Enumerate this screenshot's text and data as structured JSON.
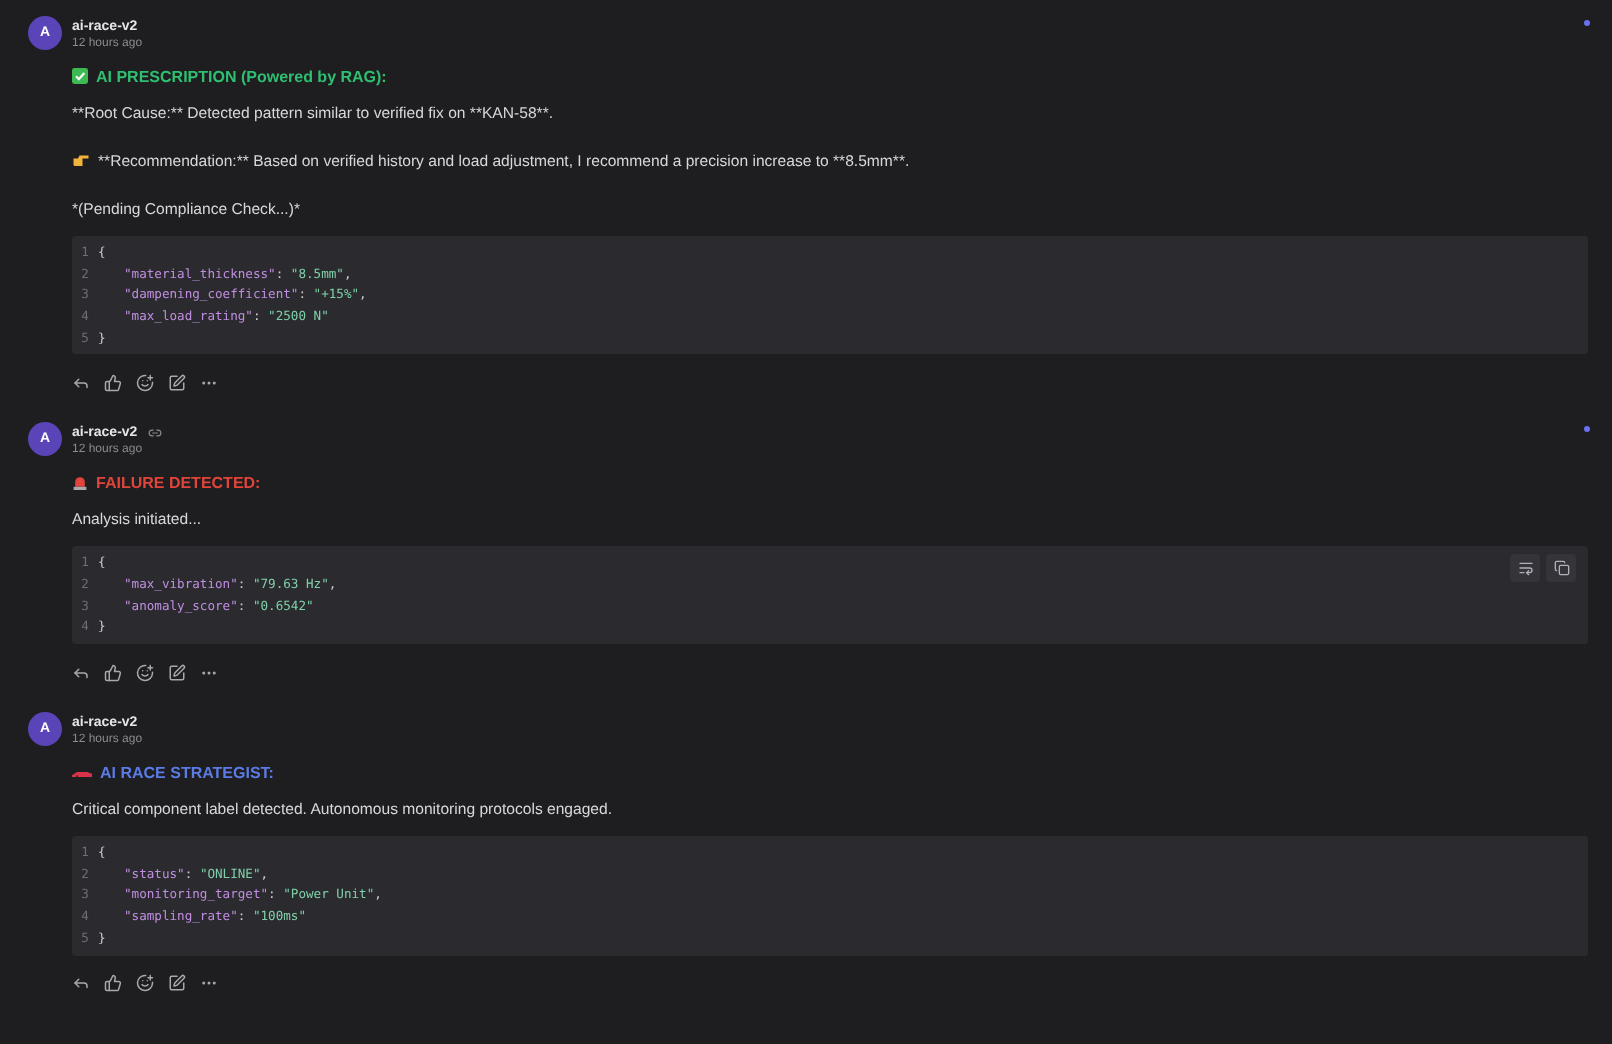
{
  "messages": [
    {
      "avatar": "A",
      "author": "ai-race-v2",
      "link": false,
      "time": "12 hours ago",
      "unread": true,
      "heading": {
        "text": "AI PRESCRIPTION (Powered by RAG):",
        "kind": "success",
        "color": "#2fbf71"
      },
      "paragraphs": [
        {
          "text": "**Root Cause:** Detected pattern similar to verified fix on **KAN-58**.",
          "kind": "plain"
        },
        {
          "text": "**Recommendation:** Based on verified history and load adjustment, I recommend a precision increase to **8.5mm**.",
          "kind": "recommendation"
        },
        {
          "text": "*(Pending Compliance Check...)*",
          "kind": "plain"
        }
      ],
      "code": {
        "tools": false,
        "lines": [
          {
            "number": "1",
            "kind": "brace",
            "text": "{"
          },
          {
            "number": "2",
            "kind": "pair",
            "key": "\"material_thickness\"",
            "sep": ": ",
            "value": "\"8.5mm\"",
            "tail": ","
          },
          {
            "number": "3",
            "kind": "pair",
            "key": "\"dampening_coefficient\"",
            "sep": ": ",
            "value": "\"+15%\"",
            "tail": ","
          },
          {
            "number": "4",
            "kind": "pair",
            "key": "\"max_load_rating\"",
            "sep": ": ",
            "value": "\"2500 N\""
          },
          {
            "number": "5",
            "kind": "brace",
            "text": "}"
          }
        ]
      }
    },
    {
      "avatar": "A",
      "author": "ai-race-v2",
      "link": true,
      "time": "12 hours ago",
      "unread": true,
      "heading": {
        "text": "FAILURE DETECTED:",
        "kind": "failure",
        "color": "#e0443a"
      },
      "paragraphs": [
        {
          "text": "Analysis initiated...",
          "kind": "plain"
        }
      ],
      "code": {
        "tools": true,
        "lines": [
          {
            "number": "1",
            "kind": "brace",
            "text": "{"
          },
          {
            "number": "2",
            "kind": "pair",
            "key": "\"max_vibration\"",
            "sep": ": ",
            "value": "\"79.63 Hz\"",
            "tail": ","
          },
          {
            "number": "3",
            "kind": "pair",
            "key": "\"anomaly_score\"",
            "sep": ": ",
            "value": "\"0.6542\""
          },
          {
            "number": "4",
            "kind": "brace",
            "text": "}"
          }
        ]
      }
    },
    {
      "avatar": "A",
      "author": "ai-race-v2",
      "link": false,
      "time": "12 hours ago",
      "unread": false,
      "heading": {
        "text": "AI RACE STRATEGIST:",
        "kind": "strategy",
        "color": "#5b7be6"
      },
      "paragraphs": [
        {
          "text": "Critical component label detected. Autonomous monitoring protocols engaged.",
          "kind": "plain"
        }
      ],
      "code": {
        "tools": false,
        "lines": [
          {
            "number": "1",
            "kind": "brace",
            "text": "{"
          },
          {
            "number": "2",
            "kind": "pair",
            "key": "\"status\"",
            "sep": ": ",
            "value": "\"ONLINE\"",
            "tail": ","
          },
          {
            "number": "3",
            "kind": "pair",
            "key": "\"monitoring_target\"",
            "sep": ": ",
            "value": "\"Power Unit\"",
            "tail": ","
          },
          {
            "number": "4",
            "kind": "pair",
            "key": "\"sampling_rate\"",
            "sep": ": ",
            "value": "\"100ms\""
          },
          {
            "number": "5",
            "kind": "brace",
            "text": "}"
          }
        ]
      }
    }
  ]
}
